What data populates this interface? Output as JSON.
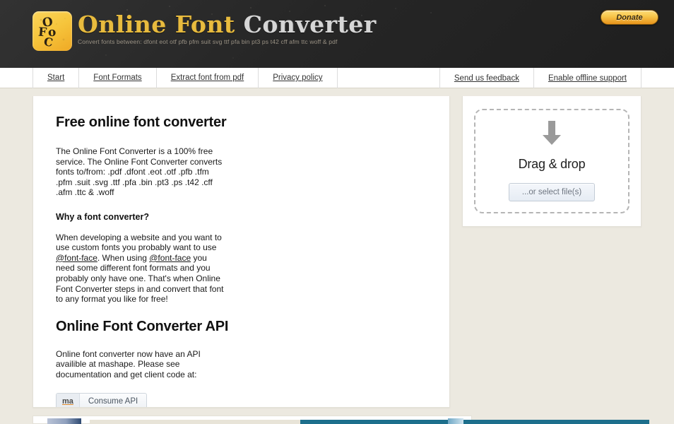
{
  "header": {
    "logo_icon": "ofc-monogram-icon",
    "logo_glyph_1": "O",
    "logo_glyph_2": "F",
    "logo_glyph_3": "C",
    "logo_glyph_4": "o",
    "title_part1": "Online Font ",
    "title_part2": "Converter",
    "tagline": "Convert fonts between: dfont eot otf pfb pfm suit svg ttf pfa bin pt3 ps t42 cff afm ttc woff & pdf",
    "donate_label": "Donate",
    "bg_color": "#272727",
    "gold_color": "#e8bb3e",
    "silver_color": "#d6d6d6"
  },
  "nav": {
    "left_items": [
      {
        "label": "Start"
      },
      {
        "label": "Font Formats"
      },
      {
        "label": "Extract font from pdf"
      },
      {
        "label": "Privacy policy"
      }
    ],
    "right_items": [
      {
        "label": "Send us feedback"
      },
      {
        "label": "Enable offline support"
      }
    ]
  },
  "main": {
    "heading": "Free online font converter",
    "intro": "The Online Font Converter is a 100% free service. The Online Font Converter converts fonts to/from: .pdf .dfont .eot .otf .pfb .tfm .pfm .suit .svg .ttf .pfa .bin .pt3 .ps .t42 .cff .afm .ttc & .woff",
    "why_heading": "Why a font converter?",
    "why_text_a": "When developing a website and you want to use custom fonts you probably want to use ",
    "why_link_1": "@font-face",
    "why_text_b": ". When using ",
    "why_link_2": "@font-face",
    "why_text_c": " you need some different font formats and you probably only have one. That's when Online Font Converter steps in and convert that font to any format you like for free!",
    "api_heading": "Online Font Converter API",
    "api_text": "Online font converter now have an API availible at mashape. Please see documentation and get client code at:",
    "api_button_badge": "ma",
    "api_button_label": "Consume API"
  },
  "dropzone": {
    "arrow_icon": "down-arrow-icon",
    "label": "Drag & drop",
    "select_button": "...or select file(s)",
    "border_color": "#b5b5b5",
    "arrow_color": "#9a9a9a"
  },
  "colors": {
    "page_background": "#ece9e0",
    "card_background": "#ffffff",
    "accent_gold": "#f6c53c"
  }
}
